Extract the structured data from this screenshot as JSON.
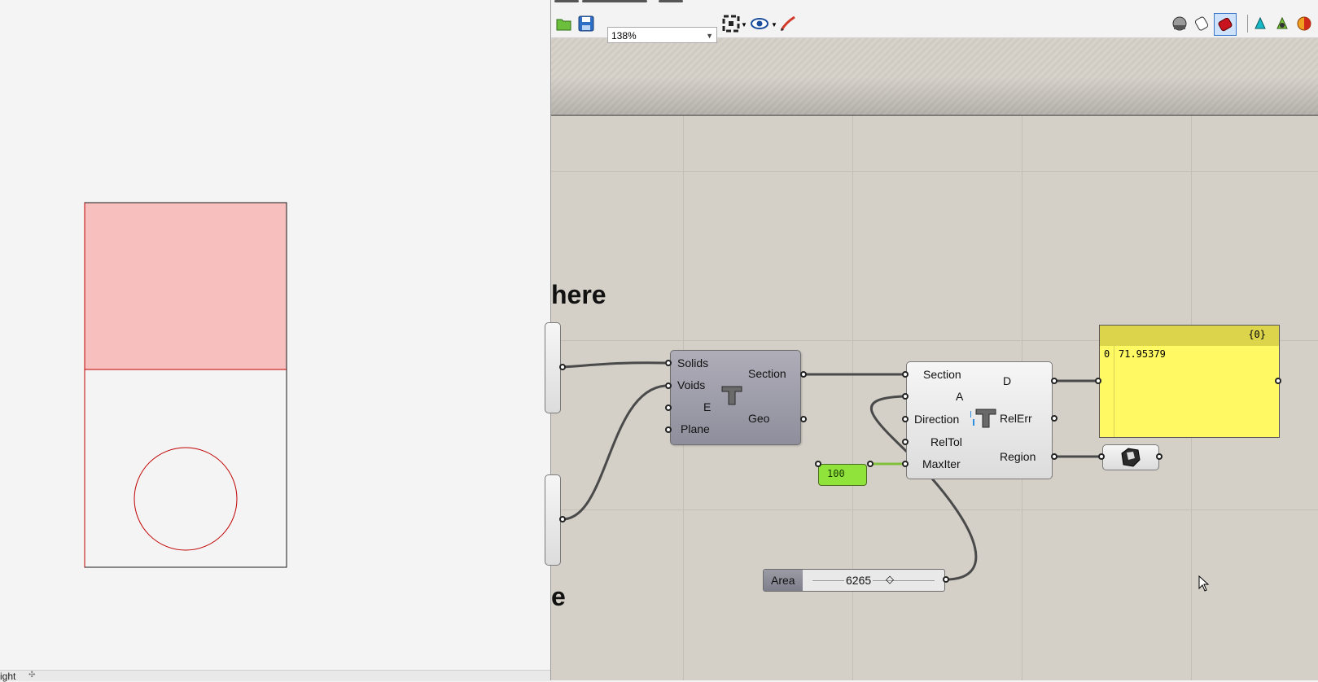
{
  "toolbar": {
    "zoom_value": "138%",
    "open_icon": "folder-open-icon",
    "save_icon": "save-icon",
    "zoom_extents_icon": "zoom-extents-icon",
    "preview_icon": "eye-icon",
    "sketch_icon": "sketch-pen-icon",
    "display_icons": [
      "preview-off-icon",
      "wireframe-preview-icon",
      "shaded-preview-icon",
      "selected-only-icon",
      "custom-preview-icon",
      "gradient-preview-icon"
    ]
  },
  "canvas": {
    "group_text_top": "here",
    "group_text_bottom": "e"
  },
  "section_component": {
    "inputs": [
      "Solids",
      "Voids",
      "E",
      "Plane"
    ],
    "outputs": [
      "Section",
      "Geo"
    ]
  },
  "solver_component": {
    "inputs": [
      "Section",
      "A",
      "Direction",
      "RelTol",
      "MaxIter"
    ],
    "outputs": [
      "D",
      "RelErr",
      "Region"
    ]
  },
  "panel": {
    "header": "{0}",
    "index": "0",
    "value": "71.95379"
  },
  "number_slider": {
    "value": "100"
  },
  "area_slider": {
    "name": "Area",
    "value": "6265"
  },
  "viewport": {
    "status_label": "ight",
    "fill_color": "#f8bfbf",
    "stroke_color": "#c00000"
  }
}
